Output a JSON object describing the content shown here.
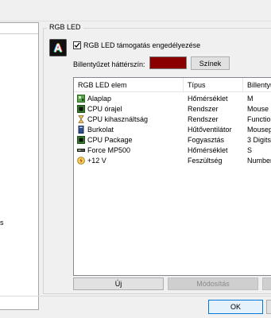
{
  "left_panel": {
    "item_text": "is"
  },
  "group": {
    "title": "RGB LED"
  },
  "enable_checkbox": {
    "label": "RGB LED támogatás engedélyezése",
    "checked": true
  },
  "background": {
    "label": "Billentyűzet háttérszín:",
    "color": "#8a0000",
    "colors_button": "Színek"
  },
  "list": {
    "headers": [
      "RGB LED elem",
      "Típus",
      "Billentyű"
    ],
    "rows": [
      {
        "icon": "motherboard-icon",
        "name": "Alaplap",
        "type": "Hőmérséklet",
        "key": "M"
      },
      {
        "icon": "cpu-icon",
        "name": "CPU órajel",
        "type": "Rendszer",
        "key": "Mouse"
      },
      {
        "icon": "hourglass-icon",
        "name": "CPU kihasználtság",
        "type": "Rendszer",
        "key": "Function"
      },
      {
        "icon": "case-icon",
        "name": "Burkolat",
        "type": "Hűtőventilátor",
        "key": "Mousepa"
      },
      {
        "icon": "cpu-icon",
        "name": "CPU Package",
        "type": "Fogyasztás",
        "key": "3 Digits"
      },
      {
        "icon": "drive-icon",
        "name": "Force MP500",
        "type": "Hőmérséklet",
        "key": "S"
      },
      {
        "icon": "voltage-icon",
        "name": "+12 V",
        "type": "Feszültség",
        "key": "Number"
      }
    ]
  },
  "buttons": {
    "new": "Új",
    "edit": "Módosítás",
    "ok": "OK"
  }
}
